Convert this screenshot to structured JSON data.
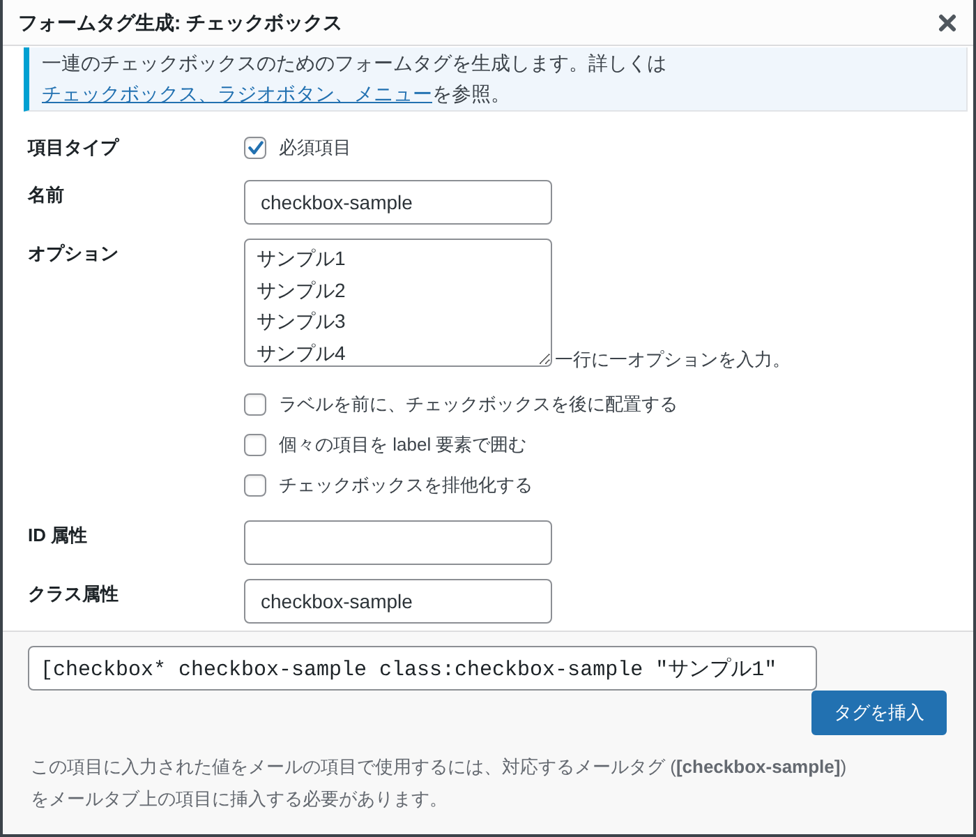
{
  "dialog": {
    "title": "フォームタグ生成: チェックボックス"
  },
  "notice": {
    "text": "一連のチェックボックスのためのフォームタグを生成します。詳しくは",
    "link": "チェックボックス、ラジオボタン、メニュー",
    "text_after": "を参照。"
  },
  "fields": [
    {
      "kind": "checkbox",
      "label": "項目タイプ",
      "option": "必須項目",
      "checked": true
    },
    {
      "kind": "text",
      "label": "名前",
      "value": "checkbox-sample"
    },
    {
      "kind": "textarea",
      "label": "オプション",
      "lines": [
        "サンプル1",
        "サンプル2",
        "サンプル3",
        "サンプル4"
      ],
      "hint": "一行に一オプションを入力。",
      "settings": [
        {
          "label": "ラベルを前に、チェックボックスを後に配置する",
          "checked": false
        },
        {
          "label": "個々の項目を label 要素で囲む",
          "checked": false
        },
        {
          "label": "チェックボックスを排他化する",
          "checked": false
        }
      ]
    },
    {
      "kind": "text",
      "label": "ID 属性"
    },
    {
      "kind": "text",
      "label": "クラス属性",
      "value": "checkbox-sample"
    }
  ],
  "footer": {
    "tag": "[checkbox* checkbox-sample class:checkbox-sample \"サンプル1\"",
    "insert_button": "タグを挿入",
    "note": "この項目に入力された値をメールの項目で使用するには、対応するメールタグ (**[checkbox-sample]**)をメールタブ上の項目に挿入する必要があります。"
  }
}
